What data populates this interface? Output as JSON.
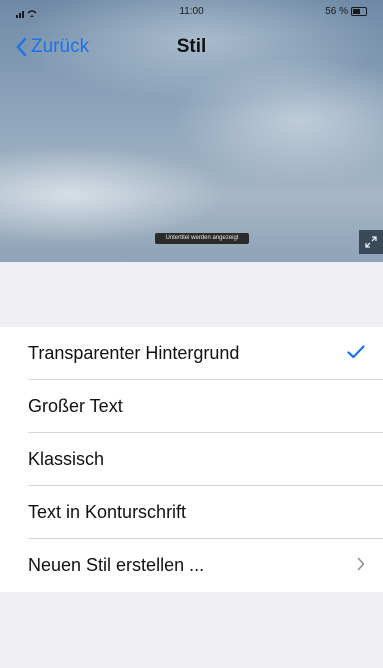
{
  "status_bar": {
    "time": "11:00",
    "battery": "56 %"
  },
  "nav": {
    "back_label": "Zurück",
    "title": "Stil"
  },
  "preview": {
    "caption": "Untertitel werden angezeigt"
  },
  "styles": {
    "items": [
      {
        "label": "Transparenter Hintergrund",
        "selected": true
      },
      {
        "label": "Großer Text"
      },
      {
        "label": "Klassisch"
      },
      {
        "label": "Text in Konturschrift"
      },
      {
        "label": "Neuen Stil erstellen ...",
        "disclosure": true
      }
    ]
  },
  "colors": {
    "accent": "#1a73e8"
  }
}
